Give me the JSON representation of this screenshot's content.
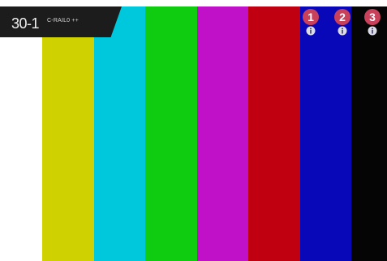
{
  "channel": {
    "number": "30-1",
    "name": "C-RAIL0 ++"
  },
  "color_bars": [
    {
      "name": "white",
      "color": "#ffffff"
    },
    {
      "name": "yellow",
      "color": "#cfd200"
    },
    {
      "name": "cyan",
      "color": "#00c8dc"
    },
    {
      "name": "green",
      "color": "#10cc10"
    },
    {
      "name": "magenta",
      "color": "#c010c8"
    },
    {
      "name": "red",
      "color": "#c00010"
    },
    {
      "name": "blue",
      "color": "#0808b8"
    },
    {
      "name": "black",
      "color": "#050505"
    }
  ],
  "markers": [
    {
      "label": "1",
      "icon": "info-icon"
    },
    {
      "label": "2",
      "icon": "info-icon"
    },
    {
      "label": "3",
      "icon": "info-icon"
    }
  ],
  "colors": {
    "banner_bg": "#1c1c1c",
    "marker_badge": "#c8405a"
  }
}
